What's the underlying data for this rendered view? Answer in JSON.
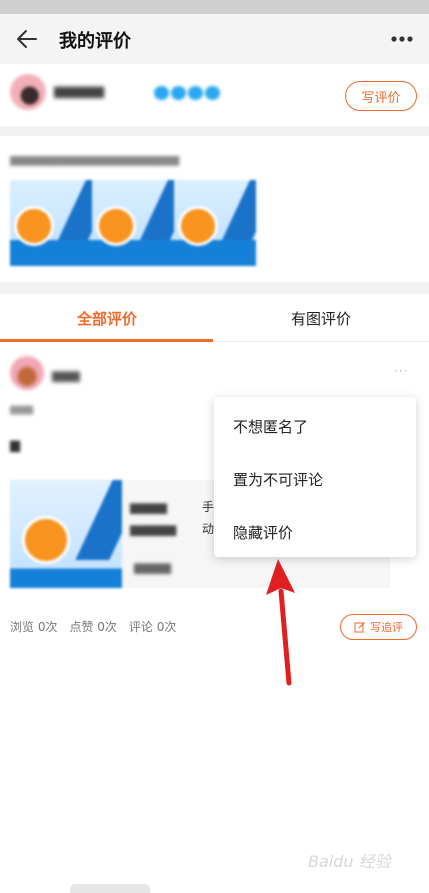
{
  "header": {
    "title": "我的评价"
  },
  "profile": {
    "write_review_label": "写评价"
  },
  "tabs": [
    {
      "label": "全部评价",
      "active": true
    },
    {
      "label": "有图评价",
      "active": false
    }
  ],
  "review": {
    "more_label": "···",
    "product_title_visible": "手\n动",
    "stats": {
      "views": "浏览 0次",
      "likes": "点赞 0次",
      "comments": "评论 0次"
    },
    "followup_label": "写追评"
  },
  "popup_menu": {
    "items": [
      "不想匿名了",
      "置为不可评论",
      "隐藏评价"
    ]
  },
  "watermark": "Baidu 经验",
  "colors": {
    "accent": "#f06a2c",
    "arrow": "#e02020"
  }
}
